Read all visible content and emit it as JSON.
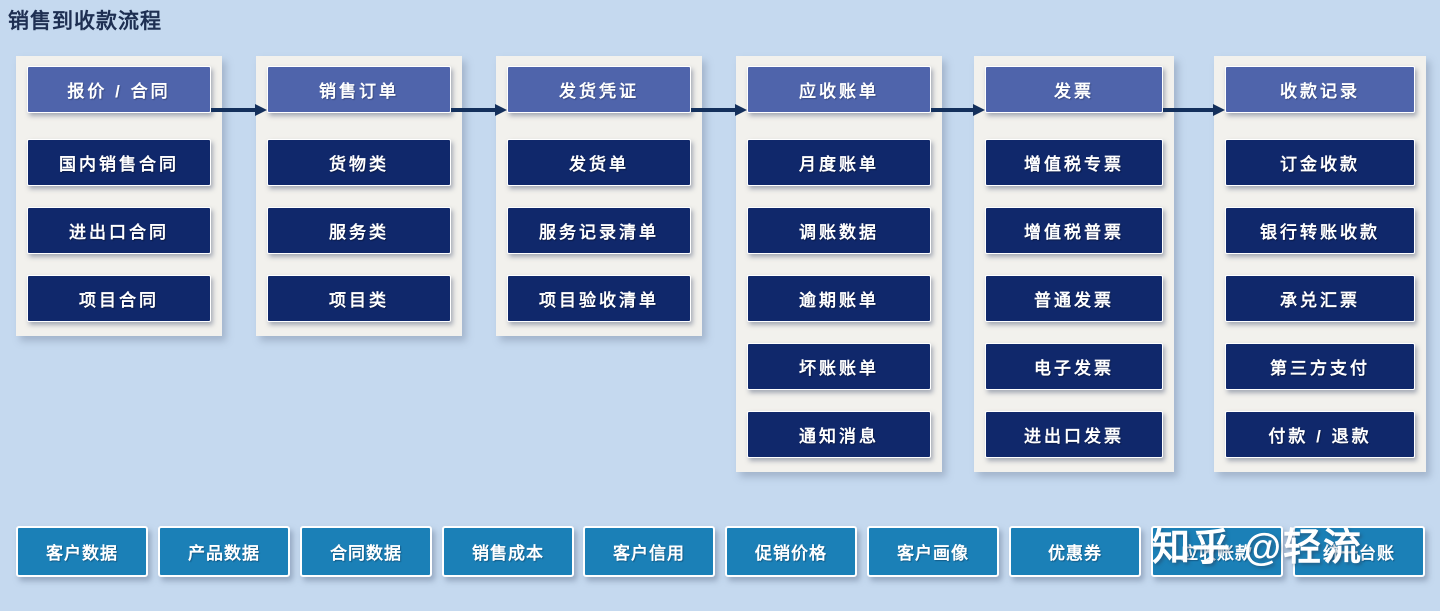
{
  "page": {
    "title": "销售到收款流程",
    "background_color": "#c5d9ef",
    "panel_color": "#f2f1ed",
    "header_color": "#4f64ab",
    "item_color": "#10286b",
    "tag_color": "#1b80b7",
    "arrow_color": "#14305c"
  },
  "flow": {
    "columns": [
      {
        "header": "报价 / 合同",
        "items": [
          "国内销售合同",
          "进出口合同",
          "项目合同"
        ]
      },
      {
        "header": "销售订单",
        "items": [
          "货物类",
          "服务类",
          "项目类"
        ]
      },
      {
        "header": "发货凭证",
        "items": [
          "发货单",
          "服务记录清单",
          "项目验收清单"
        ]
      },
      {
        "header": "应收账单",
        "items": [
          "月度账单",
          "调账数据",
          "逾期账单",
          "坏账账单",
          "通知消息"
        ]
      },
      {
        "header": "发票",
        "items": [
          "增值税专票",
          "增值税普票",
          "普通发票",
          "电子发票",
          "进出口发票"
        ]
      },
      {
        "header": "收款记录",
        "items": [
          "订金收款",
          "银行转账收款",
          "承兑汇票",
          "第三方支付",
          "付款 / 退款"
        ]
      }
    ]
  },
  "tags": [
    "客户数据",
    "产品数据",
    "合同数据",
    "销售成本",
    "客户信用",
    "促销价格",
    "客户画像",
    "优惠券",
    "应收账款",
    "统一台账"
  ],
  "watermark": {
    "brand": "知乎",
    "handle": "@轻流"
  }
}
